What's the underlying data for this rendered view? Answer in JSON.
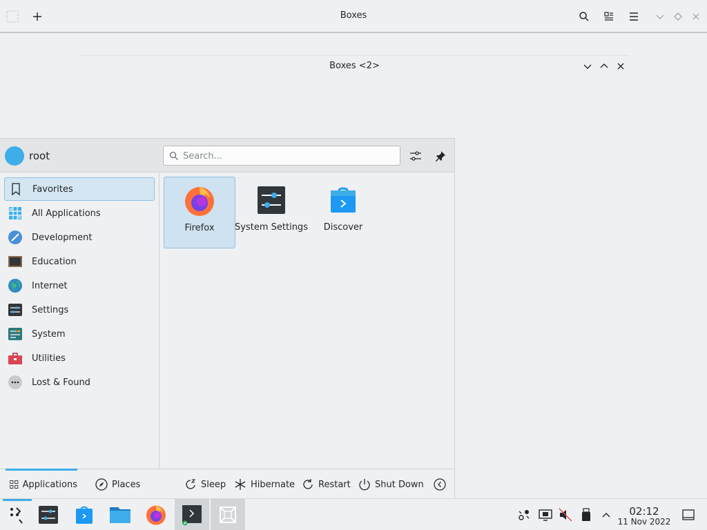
{
  "main_window": {
    "title": "Boxes"
  },
  "window2": {
    "title": "Boxes <2>"
  },
  "launcher": {
    "user": "root",
    "search_placeholder": "Search...",
    "categories": [
      {
        "label": "Favorites",
        "icon": "bookmark-icon"
      },
      {
        "label": "All Applications",
        "icon": "grid-icon"
      },
      {
        "label": "Development",
        "icon": "development-icon"
      },
      {
        "label": "Education",
        "icon": "education-icon"
      },
      {
        "label": "Internet",
        "icon": "globe-icon"
      },
      {
        "label": "Settings",
        "icon": "settings-icon"
      },
      {
        "label": "System",
        "icon": "system-icon"
      },
      {
        "label": "Utilities",
        "icon": "toolbox-icon"
      },
      {
        "label": "Lost & Found",
        "icon": "more-icon"
      }
    ],
    "favorites": [
      {
        "label": "Firefox",
        "icon": "firefox-icon"
      },
      {
        "label": "System Settings",
        "icon": "system-settings-icon"
      },
      {
        "label": "Discover",
        "icon": "discover-icon"
      }
    ],
    "footer": {
      "tabs": [
        {
          "label": "Applications"
        },
        {
          "label": "Places"
        }
      ],
      "power": [
        {
          "label": "Sleep"
        },
        {
          "label": "Hibernate"
        },
        {
          "label": "Restart"
        },
        {
          "label": "Shut Down"
        }
      ]
    }
  },
  "taskbar": {
    "clock_time": "02:12",
    "clock_date": "11 Nov 2022"
  },
  "colors": {
    "accent": "#3daee9",
    "selection": "#d5e6f3"
  }
}
